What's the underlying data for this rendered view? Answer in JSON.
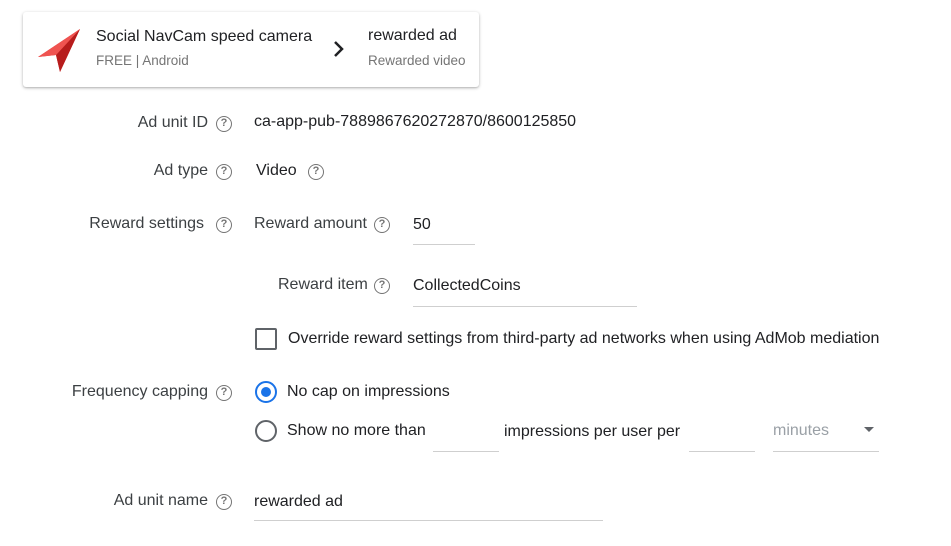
{
  "app_card": {
    "app_name": "Social NavCam speed camera",
    "app_meta": "FREE | Android",
    "ad_unit_name": "rewarded ad",
    "ad_unit_format": "Rewarded video",
    "logo_icon": "red-arrow-logo-icon",
    "accent": "#e53935"
  },
  "fields": {
    "ad_unit_id": {
      "label": "Ad unit ID",
      "value": "ca-app-pub-7889867620272870/8600125850"
    },
    "ad_type": {
      "label": "Ad type",
      "value": "Video"
    },
    "reward_settings": {
      "label": "Reward settings",
      "amount_label": "Reward amount",
      "amount_value": "50",
      "item_label": "Reward item",
      "item_value": "CollectedCoins",
      "override_label": "Override reward settings from third-party ad networks when using AdMob mediation",
      "override_checked": false
    },
    "frequency_capping": {
      "label": "Frequency capping",
      "option_no_cap": "No cap on impressions",
      "option_limit": "Show no more than",
      "impressions_text": "impressions per user per",
      "impressions_value": "",
      "period_value": "",
      "unit_placeholder": "minutes",
      "selected": "no_cap"
    },
    "ad_unit_name": {
      "label": "Ad unit name",
      "value": "rewarded ad"
    }
  },
  "help_glyph": "?",
  "colors": {
    "radio_active": "#1a73e8",
    "text_muted": "#757575"
  }
}
